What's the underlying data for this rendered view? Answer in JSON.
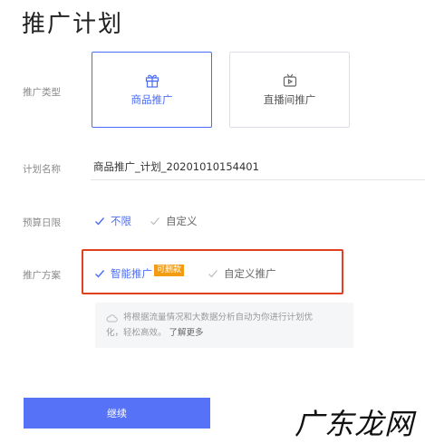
{
  "page_title": "推广计划",
  "promotion_type": {
    "label": "推广类型",
    "options": [
      {
        "label": "商品推广",
        "icon": "gift-icon",
        "selected": true
      },
      {
        "label": "直播间推广",
        "icon": "live-tv-icon",
        "selected": false
      }
    ]
  },
  "plan_name": {
    "label": "计划名称",
    "value": "商品推广_计划_20201010154401"
  },
  "budget": {
    "label": "预算日限",
    "options": [
      {
        "label": "不限",
        "selected": true
      },
      {
        "label": "自定义",
        "selected": false
      }
    ]
  },
  "scheme": {
    "label": "推广方案",
    "options": [
      {
        "label": "智能推广",
        "badge": "可删款",
        "selected": true
      },
      {
        "label": "自定义推广",
        "selected": false
      }
    ],
    "info_line1": "将根据流量情况和大数据分析自动为你进行计划优",
    "info_line2": "化，轻松高效。",
    "info_link": "了解更多"
  },
  "continue_label": "继续",
  "watermark": "广东龙网",
  "colors": {
    "accent": "#4a6cf7",
    "button": "#5672f7",
    "highlight": "#e2401f",
    "badge": "#f39c12"
  }
}
